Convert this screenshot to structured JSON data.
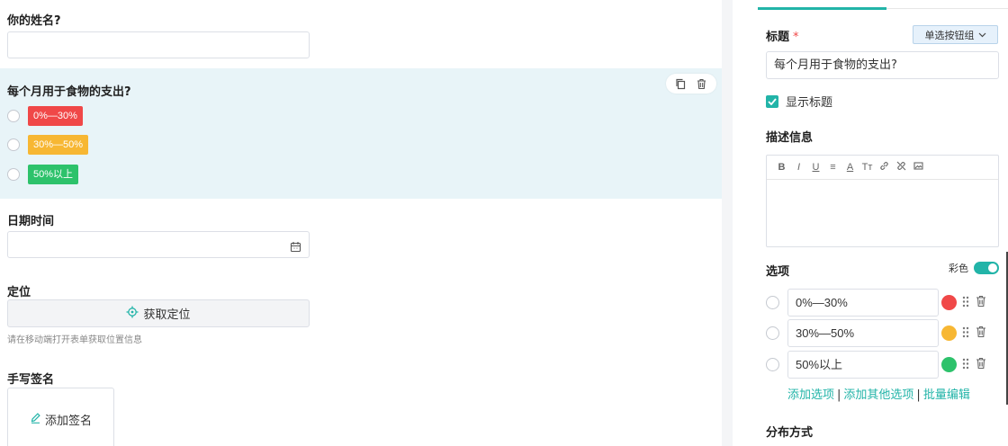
{
  "form": {
    "name_field": {
      "label": "你的姓名?",
      "value": ""
    },
    "radio_field": {
      "label": "每个月用于食物的支出?",
      "options": [
        {
          "label": "0%—30%",
          "color": "#f04848"
        },
        {
          "label": "30%—50%",
          "color": "#f7b733"
        },
        {
          "label": "50%以上",
          "color": "#2dc26b"
        }
      ],
      "copy_icon": "copy-icon",
      "delete_icon": "trash-icon"
    },
    "date_field": {
      "label": "日期时间",
      "value": "",
      "icon": "calendar-icon"
    },
    "location_field": {
      "label": "定位",
      "button_label": "获取定位",
      "hint": "请在移动端打开表单获取位置信息",
      "icon": "locate-icon"
    },
    "signature_field": {
      "label": "手写签名",
      "button_label": "添加签名",
      "icon": "pen-icon"
    }
  },
  "panel": {
    "title_label": "标题",
    "required_mark": "*",
    "type_button": "单选按钮组",
    "title_value": "每个月用于食物的支出?",
    "show_title": {
      "label": "显示标题",
      "checked": true
    },
    "description_label": "描述信息",
    "editor_tools": [
      "B",
      "I",
      "U",
      "≡",
      "A",
      "Tт"
    ],
    "options_label": "选项",
    "color_toggle": {
      "label": "彩色",
      "on": true
    },
    "options": [
      {
        "value": "0%—30%",
        "color": "#f04848"
      },
      {
        "value": "30%—50%",
        "color": "#f7b733"
      },
      {
        "value": "50%以上",
        "color": "#2dc26b"
      }
    ],
    "links": {
      "add_option": "添加选项",
      "add_other": "添加其他选项",
      "batch_edit": "批量编辑",
      "separator": "|"
    },
    "distribution_label": "分布方式"
  },
  "colors": {
    "accent": "#22b4a8",
    "selected_bg": "#e8f4f8"
  }
}
